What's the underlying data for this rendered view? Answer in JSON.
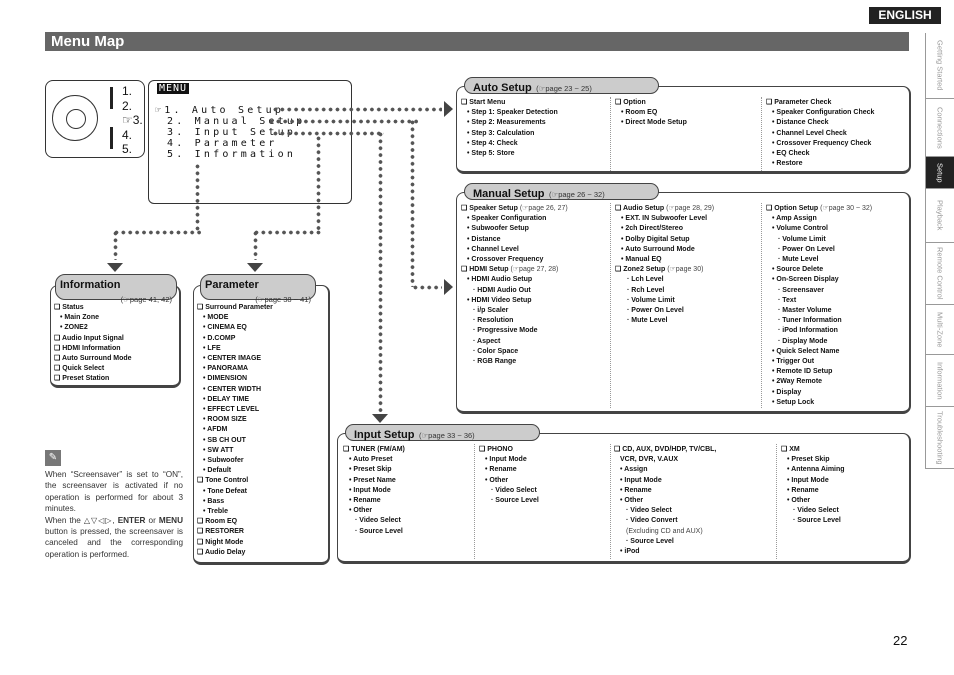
{
  "header": {
    "language": "ENGLISH",
    "title": "Menu Map"
  },
  "side_tabs": [
    {
      "label": "Getting Started",
      "active": false
    },
    {
      "label": "Connections",
      "active": false
    },
    {
      "label": "Setup",
      "active": true
    },
    {
      "label": "Playback",
      "active": false
    },
    {
      "label": "Remote Control",
      "active": false
    },
    {
      "label": "Multi-Zone",
      "active": false
    },
    {
      "label": "Information",
      "active": false
    },
    {
      "label": "Troubleshooting",
      "active": false
    }
  ],
  "remote": {
    "numbers": [
      "1.",
      "2.",
      "☞3.",
      "4.",
      "5."
    ]
  },
  "menu_screen": {
    "label": "MENU",
    "items": [
      "☞1. Auto Setup",
      " 2. Manual Setup",
      " 3. Input Setup",
      " 4. Parameter",
      " 5. Information"
    ]
  },
  "auto_setup": {
    "title": "Auto Setup",
    "ref": "(☞page 23 ~ 25)",
    "cols": [
      [
        {
          "t": "h",
          "v": "❑ Start Menu"
        },
        {
          "t": "b",
          "v": "• Step 1: Speaker Detection"
        },
        {
          "t": "b",
          "v": "• Step 2: Measurements"
        },
        {
          "t": "b",
          "v": "• Step 3: Calculation"
        },
        {
          "t": "b",
          "v": "• Step 4: Check"
        },
        {
          "t": "b",
          "v": "• Step 5: Store"
        }
      ],
      [
        {
          "t": "h",
          "v": "❑ Option"
        },
        {
          "t": "b",
          "v": "• Room EQ"
        },
        {
          "t": "b",
          "v": "• Direct Mode Setup"
        }
      ],
      [
        {
          "t": "h",
          "v": "❑ Parameter Check"
        },
        {
          "t": "b",
          "v": "• Speaker Configuration Check"
        },
        {
          "t": "b",
          "v": "• Distance Check"
        },
        {
          "t": "b",
          "v": "• Channel Level Check"
        },
        {
          "t": "b",
          "v": "• Crossover Frequency Check"
        },
        {
          "t": "b",
          "v": "• EQ Check"
        },
        {
          "t": "b",
          "v": "• Restore"
        }
      ]
    ]
  },
  "manual_setup": {
    "title": "Manual Setup",
    "ref": "(☞page 26 ~ 32)",
    "cols": [
      [
        {
          "t": "h",
          "v": "❑ Speaker Setup",
          "r": "(☞page 26, 27)"
        },
        {
          "t": "b",
          "v": "• Speaker Configuration"
        },
        {
          "t": "b",
          "v": "• Subwoofer Setup"
        },
        {
          "t": "b",
          "v": "• Distance"
        },
        {
          "t": "b",
          "v": "• Channel Level"
        },
        {
          "t": "b",
          "v": "• Crossover Frequency"
        },
        {
          "t": "h",
          "v": "❑ HDMI Setup",
          "r": "(☞page 27, 28)"
        },
        {
          "t": "b",
          "v": "• HDMI Audio Setup"
        },
        {
          "t": "d",
          "v": "· HDMI Audio Out"
        },
        {
          "t": "b",
          "v": "• HDMI Video Setup"
        },
        {
          "t": "d",
          "v": "· i/p Scaler"
        },
        {
          "t": "d",
          "v": "· Resolution"
        },
        {
          "t": "d",
          "v": "· Progressive Mode"
        },
        {
          "t": "d",
          "v": "· Aspect"
        },
        {
          "t": "d",
          "v": "· Color Space"
        },
        {
          "t": "d",
          "v": "· RGB Range"
        }
      ],
      [
        {
          "t": "h",
          "v": "❑ Audio Setup",
          "r": "(☞page 28, 29)"
        },
        {
          "t": "b",
          "v": "• EXT. IN Subwoofer Level"
        },
        {
          "t": "b",
          "v": "• 2ch Direct/Stereo"
        },
        {
          "t": "b",
          "v": "• Dolby Digital Setup"
        },
        {
          "t": "b",
          "v": "• Auto Surround Mode"
        },
        {
          "t": "b",
          "v": "• Manual EQ"
        },
        {
          "t": "h",
          "v": "❑ Zone2 Setup",
          "r": "(☞page 30)"
        },
        {
          "t": "d",
          "v": "· Lch Level"
        },
        {
          "t": "d",
          "v": "· Rch Level"
        },
        {
          "t": "d",
          "v": "· Volume Limit"
        },
        {
          "t": "d",
          "v": "· Power On Level"
        },
        {
          "t": "d",
          "v": "· Mute Level"
        }
      ],
      [
        {
          "t": "h",
          "v": "❑ Option Setup",
          "r": "(☞page 30 ~ 32)"
        },
        {
          "t": "b",
          "v": "• Amp Assign"
        },
        {
          "t": "b",
          "v": "• Volume Control"
        },
        {
          "t": "d",
          "v": "· Volume Limit"
        },
        {
          "t": "d",
          "v": "· Power On Level"
        },
        {
          "t": "d",
          "v": "· Mute Level"
        },
        {
          "t": "b",
          "v": "• Source Delete"
        },
        {
          "t": "b",
          "v": "• On-Screen Display"
        },
        {
          "t": "d",
          "v": "· Screensaver"
        },
        {
          "t": "d",
          "v": "· Text"
        },
        {
          "t": "d",
          "v": "· Master Volume"
        },
        {
          "t": "d",
          "v": "· Tuner Information"
        },
        {
          "t": "d",
          "v": "· iPod Information"
        },
        {
          "t": "d",
          "v": "· Display Mode"
        },
        {
          "t": "b",
          "v": "• Quick Select Name"
        },
        {
          "t": "b",
          "v": "• Trigger Out"
        },
        {
          "t": "b",
          "v": "• Remote ID Setup"
        },
        {
          "t": "b",
          "v": "• 2Way Remote"
        },
        {
          "t": "b",
          "v": "• Display"
        },
        {
          "t": "b",
          "v": "• Setup Lock"
        }
      ]
    ]
  },
  "input_setup": {
    "title": "Input Setup",
    "ref": "(☞page 33 ~ 36)",
    "cols": [
      [
        {
          "t": "h",
          "v": "❑ TUNER (FM/AM)"
        },
        {
          "t": "b",
          "v": "• Auto Preset"
        },
        {
          "t": "b",
          "v": "• Preset Skip"
        },
        {
          "t": "b",
          "v": "• Preset Name"
        },
        {
          "t": "b",
          "v": "• Input Mode"
        },
        {
          "t": "b",
          "v": "• Rename"
        },
        {
          "t": "b",
          "v": "• Other"
        },
        {
          "t": "d",
          "v": "· Video Select"
        },
        {
          "t": "d",
          "v": "· Source Level"
        }
      ],
      [
        {
          "t": "h",
          "v": "❑ PHONO"
        },
        {
          "t": "b",
          "v": "• Input Mode"
        },
        {
          "t": "b",
          "v": "• Rename"
        },
        {
          "t": "b",
          "v": "• Other"
        },
        {
          "t": "d",
          "v": "· Video Select"
        },
        {
          "t": "d",
          "v": "· Source Level"
        }
      ],
      [
        {
          "t": "h",
          "v": "❑ CD, AUX, DVD/HDP, TV/CBL,"
        },
        {
          "t": "h2",
          "v": "VCR, DVR, V.AUX"
        },
        {
          "t": "b",
          "v": "• Assign"
        },
        {
          "t": "b",
          "v": "• Input Mode"
        },
        {
          "t": "b",
          "v": "• Rename"
        },
        {
          "t": "b",
          "v": "• Other"
        },
        {
          "t": "d",
          "v": "· Video Select"
        },
        {
          "t": "d",
          "v": "· Video Convert"
        },
        {
          "t": "n",
          "v": "(Excluding CD and AUX)"
        },
        {
          "t": "d",
          "v": "· Source Level"
        },
        {
          "t": "b",
          "v": "• iPod"
        }
      ],
      [
        {
          "t": "h",
          "v": "❑ XM"
        },
        {
          "t": "b",
          "v": "• Preset Skip"
        },
        {
          "t": "b",
          "v": "• Antenna Aiming"
        },
        {
          "t": "b",
          "v": "• Input Mode"
        },
        {
          "t": "b",
          "v": "• Rename"
        },
        {
          "t": "b",
          "v": "• Other"
        },
        {
          "t": "d",
          "v": "· Video Select"
        },
        {
          "t": "d",
          "v": "· Source Level"
        }
      ]
    ]
  },
  "information": {
    "title": "Information",
    "ref": "(☞page 41, 42)",
    "cols": [
      [
        {
          "t": "h",
          "v": "❑ Status"
        },
        {
          "t": "b",
          "v": "• Main Zone"
        },
        {
          "t": "b",
          "v": "• ZONE2"
        },
        {
          "t": "h",
          "v": "❑ Audio Input Signal"
        },
        {
          "t": "h",
          "v": "❑ HDMI Information"
        },
        {
          "t": "h",
          "v": "❑ Auto Surround Mode"
        },
        {
          "t": "h",
          "v": "❑ Quick Select"
        },
        {
          "t": "h",
          "v": "❑ Preset Station"
        }
      ]
    ]
  },
  "parameter": {
    "title": "Parameter",
    "ref": "(☞page 38 ~ 41)",
    "cols": [
      [
        {
          "t": "h",
          "v": "❑ Surround Parameter"
        },
        {
          "t": "b",
          "v": "• MODE"
        },
        {
          "t": "b",
          "v": "• CINEMA EQ"
        },
        {
          "t": "b",
          "v": "• D.COMP"
        },
        {
          "t": "b",
          "v": "• LFE"
        },
        {
          "t": "b",
          "v": "• CENTER IMAGE"
        },
        {
          "t": "b",
          "v": "• PANORAMA"
        },
        {
          "t": "b",
          "v": "• DIMENSION"
        },
        {
          "t": "b",
          "v": "• CENTER WIDTH"
        },
        {
          "t": "b",
          "v": "• DELAY TIME"
        },
        {
          "t": "b",
          "v": "• EFFECT LEVEL"
        },
        {
          "t": "b",
          "v": "• ROOM SIZE"
        },
        {
          "t": "b",
          "v": "• AFDM"
        },
        {
          "t": "b",
          "v": "• SB CH OUT"
        },
        {
          "t": "b",
          "v": "• SW ATT"
        },
        {
          "t": "b",
          "v": "• Subwoofer"
        },
        {
          "t": "b",
          "v": "• Default"
        },
        {
          "t": "h",
          "v": "❑ Tone Control"
        },
        {
          "t": "b",
          "v": "• Tone Defeat"
        },
        {
          "t": "b",
          "v": "• Bass"
        },
        {
          "t": "b",
          "v": "• Treble"
        },
        {
          "t": "h",
          "v": "❑ Room EQ"
        },
        {
          "t": "h",
          "v": "❑ RESTORER"
        },
        {
          "t": "h",
          "v": "❑ Night Mode"
        },
        {
          "t": "h",
          "v": "❑ Audio Delay"
        }
      ]
    ]
  },
  "note": {
    "icon": "pencil-icon",
    "text1": "When “Screensaver” is set to “ON”, the screensaver is activated if no operation is performed for about 3 minutes.",
    "text2_pre": "When the △▽◁▷, ",
    "enter": "ENTER",
    "or": " or ",
    "menu": "MENU",
    "text2_post": " button is pressed, the screensaver is canceled and the corresponding operation is performed."
  },
  "page_number": "22"
}
